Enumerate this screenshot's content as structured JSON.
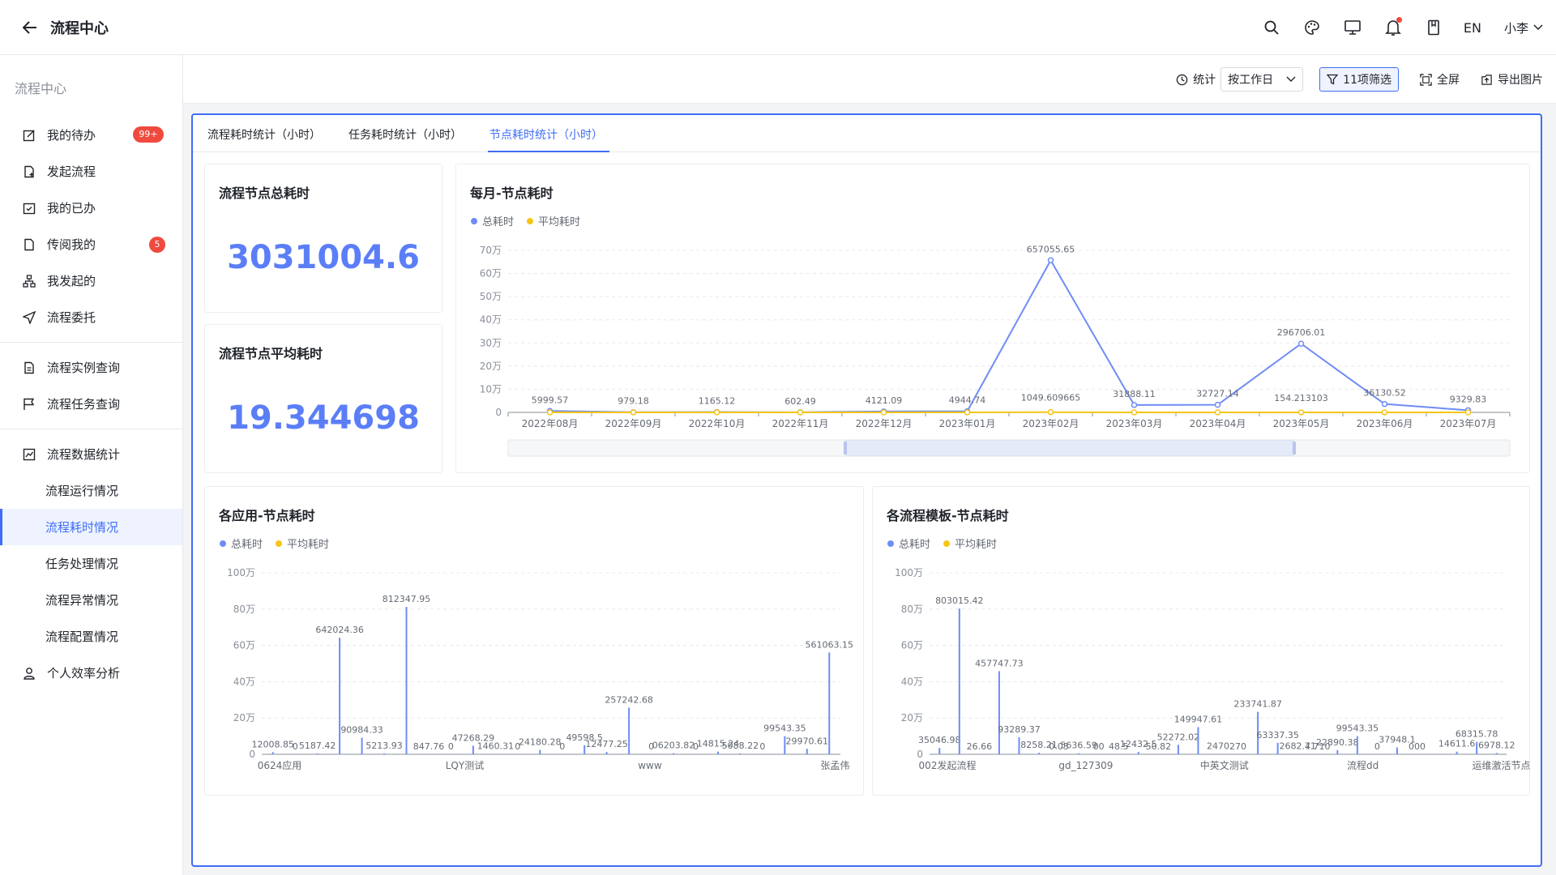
{
  "header": {
    "title": "流程中心",
    "lang": "EN",
    "user": "小李"
  },
  "sidebar": {
    "title": "流程中心",
    "items": [
      {
        "label": "我的待办",
        "badge": "99+"
      },
      {
        "label": "发起流程"
      },
      {
        "label": "我的已办"
      },
      {
        "label": "传阅我的",
        "badge": "5"
      },
      {
        "label": "我发起的"
      },
      {
        "label": "流程委托"
      },
      {
        "label": "流程实例查询"
      },
      {
        "label": "流程任务查询"
      },
      {
        "label": "流程数据统计"
      },
      {
        "label": "流程运行情况"
      },
      {
        "label": "流程耗时情况"
      },
      {
        "label": "任务处理情况"
      },
      {
        "label": "流程异常情况"
      },
      {
        "label": "流程配置情况"
      },
      {
        "label": "个人效率分析"
      }
    ]
  },
  "toolbar": {
    "stat_label": "统计",
    "stat_select": "按工作日",
    "filter_label": "11项筛选",
    "fullscreen": "全屏",
    "export": "导出图片"
  },
  "tabs": [
    "流程耗时统计（小时）",
    "任务耗时统计（小时）",
    "节点耗时统计（小时）"
  ],
  "cards": {
    "total": {
      "title": "流程节点总耗时",
      "value": "3031004.6"
    },
    "avg": {
      "title": "流程节点平均耗时",
      "value": "19.344698"
    }
  },
  "legend": {
    "total": "总耗时",
    "avg": "平均耗时"
  },
  "colors": {
    "accent": "#3f6df6",
    "series_total": "#6f8cf5",
    "series_avg": "#f5c518",
    "badge": "#f04a3e"
  },
  "chart_data": [
    {
      "type": "line",
      "title": "每月-节点耗时",
      "x": [
        "2022年08月",
        "2022年09月",
        "2022年10月",
        "2022年11月",
        "2022年12月",
        "2023年01月",
        "2023年02月",
        "2023年03月",
        "2023年04月",
        "2023年05月",
        "2023年06月",
        "2023年07月"
      ],
      "ylim": [
        0,
        700000
      ],
      "yticks": [
        "0",
        "10万",
        "20万",
        "30万",
        "40万",
        "50万",
        "60万",
        "70万"
      ],
      "series": [
        {
          "name": "总耗时",
          "values": [
            5999.57,
            979.18,
            1165.12,
            602.49,
            4121.09,
            4944.74,
            657055.65,
            31888.11,
            32727.14,
            296706.01,
            36130.52,
            9329.83
          ],
          "labels": [
            "5999.57",
            "979.18",
            "1165.12",
            "602.49",
            "4121.09",
            "4944.74",
            "657055.65",
            "31888.11",
            "32727.14",
            "296706.01",
            "36130.52",
            "9329.83"
          ]
        },
        {
          "name": "平均耗时",
          "values": [
            0,
            0,
            0,
            0,
            0,
            0,
            1049.609665,
            0,
            0,
            154.213103,
            0,
            0
          ],
          "labels": [
            "",
            "",
            "",
            "",
            "",
            "",
            "1049.609665",
            "",
            "",
            "154.213103",
            "",
            ""
          ]
        }
      ],
      "legend": "top-left",
      "grid": true
    },
    {
      "type": "bar",
      "title": "各应用-节点耗时",
      "x_ticks": [
        "0624应用",
        "LQY测试",
        "www",
        "张孟伟"
      ],
      "ylim": [
        0,
        1000000
      ],
      "yticks": [
        "0",
        "20万",
        "40万",
        "60万",
        "80万",
        "100万"
      ],
      "series": [
        {
          "name": "总耗时",
          "values": [
            12008.85,
            0,
            5187.42,
            642024.36,
            90984.33,
            5213.93,
            812347.95,
            847.76,
            0,
            47268.29,
            1460.31,
            0,
            24180.28,
            0,
            49598.5,
            12477.25,
            257242.68,
            0,
            6203.82,
            0,
            14815.24,
            5088.22,
            0,
            99543.35,
            29970.61,
            561063.15
          ],
          "labels": [
            "12008.85",
            "0",
            "5187.42",
            "642024.36",
            "90984.33",
            "5213.93",
            "812347.95",
            "847.76",
            "0",
            "47268.29",
            "1460.31",
            "0",
            "24180.28",
            "0",
            "49598.5",
            "12477.25",
            "257242.68",
            "0",
            "06203.82",
            "0",
            "14815.24",
            "5088.22",
            "0",
            "99543.35",
            "29970.61",
            "561063.15"
          ]
        }
      ],
      "legend": "top-left"
    },
    {
      "type": "bar",
      "title": "各流程模板-节点耗时",
      "x_ticks": [
        "002发起流程",
        "gd_127309",
        "中英文测试",
        "流程dd",
        "运维激活节点"
      ],
      "ylim": [
        0,
        1000000
      ],
      "yticks": [
        "0",
        "20万",
        "40万",
        "60万",
        "80万",
        "100万"
      ],
      "series": [
        {
          "name": "总耗时",
          "values": [
            35046.98,
            803015.42,
            26.66,
            457747.73,
            93289.37,
            8258.21,
            0.05,
            5636.59,
            0,
            48.5,
            12432.5,
            50.82,
            52272.02,
            149947.61,
            2470.27,
            0,
            233741.87,
            63337.35,
            2682.71,
            4.71,
            22890.38,
            99543.35,
            0,
            37948.1,
            0,
            0,
            14611.6,
            68315.78,
            6978.12
          ],
          "labels": [
            "35046.98",
            "803015.42",
            "26.66",
            "457747.73",
            "93289.37",
            "8258.21",
            "0.05",
            "5636.59",
            "00",
            "48.5",
            "12432.5",
            "50.82",
            "52272.02",
            "149947.61",
            "2470",
            "270",
            "233741.87",
            "63337.35",
            "2682.71",
            "4.710",
            "22890.38",
            "99543.35",
            "0",
            "37948.1",
            "000",
            "",
            "14611.6",
            "68315.78",
            "6978.12"
          ]
        }
      ],
      "legend": "top-left"
    }
  ]
}
